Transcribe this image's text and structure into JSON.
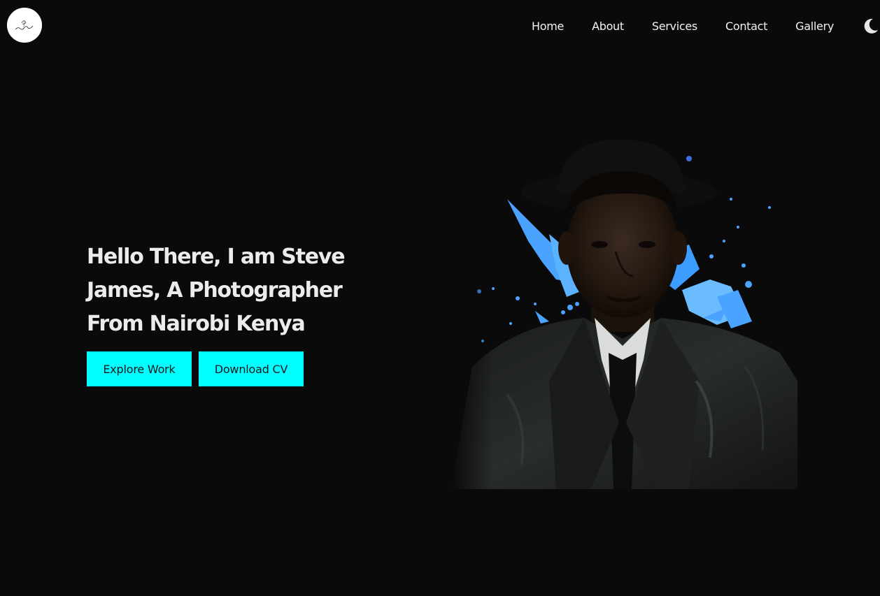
{
  "header": {
    "logo_icon": "photographer-signature-logo",
    "nav": [
      {
        "label": "Home"
      },
      {
        "label": "About"
      },
      {
        "label": "Services"
      },
      {
        "label": "Contact"
      },
      {
        "label": "Gallery"
      }
    ],
    "theme_toggle_icon": "moon-icon"
  },
  "hero": {
    "heading": "Hello There, I am Steve James, A Photographer From Nairobi Kenya",
    "buttons": {
      "explore": "Explore Work",
      "download_cv": "Download CV"
    },
    "image_subject": "portrait-of-man-in-hat-and-leather-jacket-with-blue-paint-splash"
  },
  "colors": {
    "background": "#0a0a0b",
    "accent": "#00ffff",
    "text": "#ececec",
    "splash": "#4aa3ff"
  }
}
